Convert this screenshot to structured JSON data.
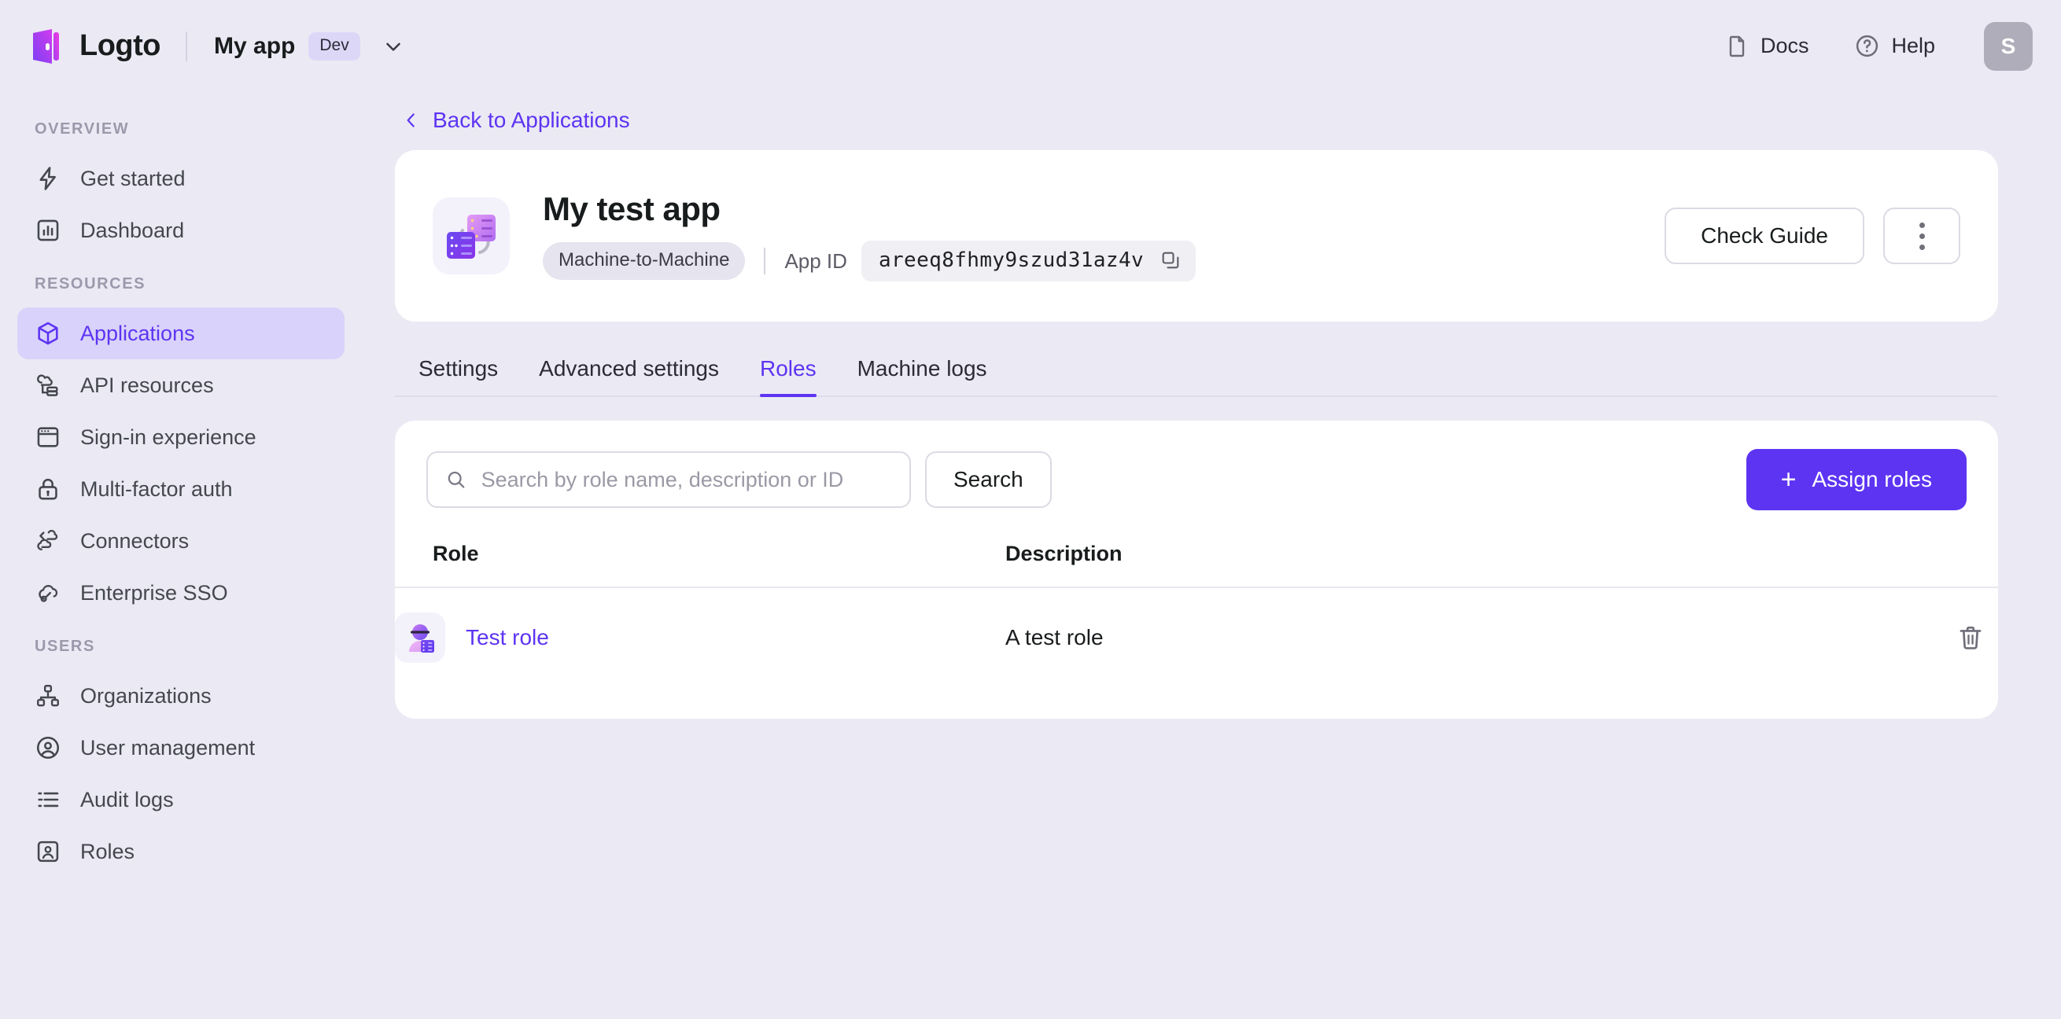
{
  "topbar": {
    "brand_name": "Logto",
    "tenant_name": "My app",
    "tenant_badge": "Dev",
    "docs_label": "Docs",
    "help_label": "Help",
    "avatar_initial": "S"
  },
  "sidebar": {
    "sections": [
      {
        "title": "Overview",
        "items": [
          {
            "label": "Get started",
            "icon": "lightning-icon",
            "active": false
          },
          {
            "label": "Dashboard",
            "icon": "chart-icon",
            "active": false
          }
        ]
      },
      {
        "title": "Resources",
        "items": [
          {
            "label": "Applications",
            "icon": "cube-icon",
            "active": true
          },
          {
            "label": "API resources",
            "icon": "api-cloud-icon",
            "active": false
          },
          {
            "label": "Sign-in experience",
            "icon": "browser-window-icon",
            "active": false
          },
          {
            "label": "Multi-factor auth",
            "icon": "lock-icon",
            "active": false
          },
          {
            "label": "Connectors",
            "icon": "connectors-cloud-icon",
            "active": false
          },
          {
            "label": "Enterprise SSO",
            "icon": "cloud-key-icon",
            "active": false
          }
        ]
      },
      {
        "title": "Users",
        "items": [
          {
            "label": "Organizations",
            "icon": "org-tree-icon",
            "active": false
          },
          {
            "label": "User management",
            "icon": "user-circle-icon",
            "active": false
          },
          {
            "label": "Audit logs",
            "icon": "list-icon",
            "active": false
          },
          {
            "label": "Roles",
            "icon": "user-square-icon",
            "active": false
          }
        ]
      }
    ]
  },
  "main": {
    "back_link": "Back to Applications",
    "app": {
      "title": "My test app",
      "type_badge": "Machine-to-Machine",
      "app_id_label": "App ID",
      "app_id_value": "areeq8fhmy9szud31az4v",
      "check_guide_label": "Check Guide"
    },
    "tabs": [
      {
        "label": "Settings",
        "active": false
      },
      {
        "label": "Advanced settings",
        "active": false
      },
      {
        "label": "Roles",
        "active": true
      },
      {
        "label": "Machine logs",
        "active": false
      }
    ],
    "roles_panel": {
      "search_placeholder": "Search by role name, description or ID",
      "search_value": "",
      "search_button_label": "Search",
      "assign_button_label": "Assign roles",
      "columns": [
        "Role",
        "Description"
      ],
      "rows": [
        {
          "role": "Test role",
          "description": "A test role"
        }
      ]
    }
  },
  "colors": {
    "accent": "#5d34f2",
    "page_bg": "#ebeaf4",
    "card_bg": "#ffffff",
    "sidebar_active_bg": "#d9d2fa",
    "badge_bg": "#ddd7f7"
  }
}
